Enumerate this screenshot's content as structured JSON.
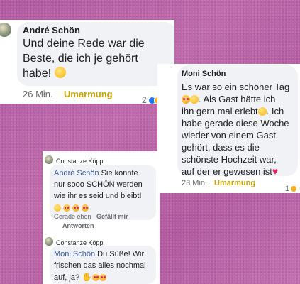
{
  "comment_andre": {
    "author": "André Schön",
    "text": "Und deine Rede war die Beste, die ich je gehört habe!",
    "emoji": "smile-emoji",
    "time": "26 Min.",
    "reaction_label": "Umarmung",
    "reaction_count": "2"
  },
  "comment_moni": {
    "author": "Moni Schön",
    "line1": "Es war so ein schöner Tag",
    "line2_text": "Als Gast hätte ich",
    "line3": "ihn gern mal erlebt",
    "line3_tail": "Ich",
    "line4": "habe gerade diese Woche",
    "line5": "wieder von einem Gast",
    "line6": "gehört, dass es die",
    "line7": "schönste Hochzeit war,",
    "line8": "auf der er gewesen ist",
    "time": "23 Min.",
    "reaction_label": "Umarmung",
    "reaction_count": "1"
  },
  "reply_one": {
    "author": "Constanze Köpp",
    "mention": "André Schön",
    "text_part1": "Sie konnte",
    "text_line2": "nur sooo SCHÖN werden",
    "text_line3": "wie ihr es seid und bleibt!",
    "time": "Gerade eben",
    "like_label": "Gefällt mir",
    "reply_label": "Antworten"
  },
  "reply_two": {
    "author": "Constanze Köpp",
    "mention": "Moni Schön",
    "text_part1": "Du Süße! Wir",
    "text_line2": "frischen das alles nochmal",
    "text_line3": "auf, ja?"
  },
  "colors": {
    "background": "#b560a5",
    "link": "#385898",
    "hug": "#c9a400",
    "meta": "#65676b",
    "bubble": "#f0f2f5"
  }
}
